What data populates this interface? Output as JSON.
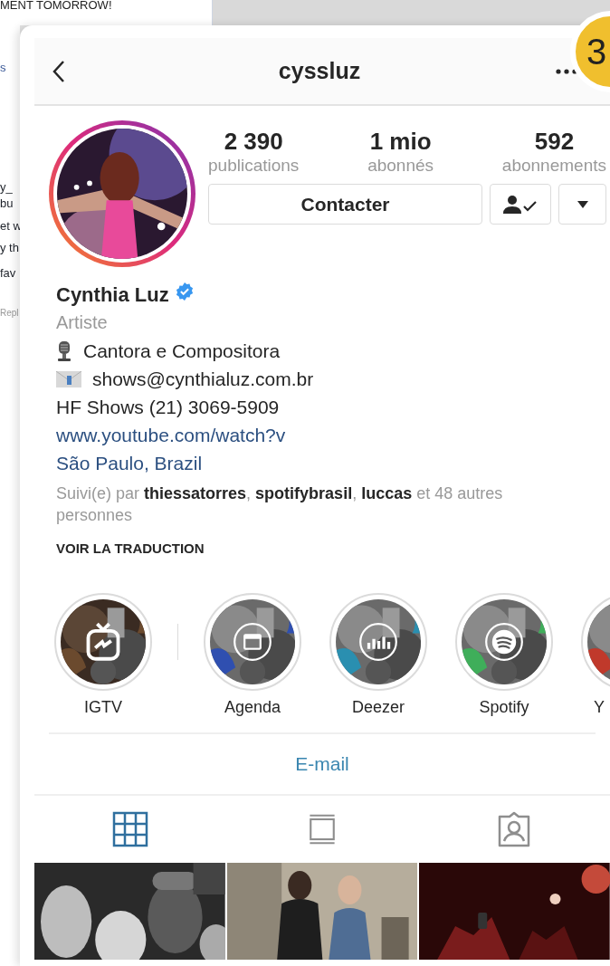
{
  "background": {
    "headline": "MENT TOMORROW!",
    "fragments": [
      {
        "text": "s",
        "kind": "link"
      },
      {
        "text": "y_",
        "kind": "text"
      },
      {
        "text": "bu",
        "kind": "text"
      },
      {
        "text": "et w",
        "kind": "text"
      },
      {
        "text": "y th",
        "kind": "text"
      },
      {
        "text": "fav",
        "kind": "text"
      },
      {
        "text": "Repl",
        "kind": "meta"
      }
    ]
  },
  "badge": "3",
  "header": {
    "title": "cyssluz"
  },
  "stats": [
    {
      "value": "2 390",
      "label": "publications"
    },
    {
      "value": "1 mio",
      "label": "abonnés"
    },
    {
      "value": "592",
      "label": "abonnements"
    }
  ],
  "buttons": {
    "contact": "Contacter",
    "following": true
  },
  "profile": {
    "name": "Cynthia Luz",
    "verified": true,
    "category": "Artiste"
  },
  "bio": [
    {
      "kind": "mic",
      "text": "Cantora e Compositora"
    },
    {
      "kind": "mail",
      "text": "shows@cynthialuz.com.br"
    },
    {
      "kind": "text",
      "text": "HF Shows (21) 3069-5909"
    },
    {
      "kind": "link",
      "text": "www.youtube.com/watch?v"
    },
    {
      "kind": "link",
      "text": "São Paulo, Brazil"
    }
  ],
  "followed_by": "Suivi(e) par **thiessatorres**, **spotifybrasil**, **luccas** et 48 autres personnes",
  "translate": "VOIR LA TRADUCTION",
  "highlights": [
    {
      "label": "IGTV",
      "kind": "tv"
    },
    {
      "label": "Agenda",
      "kind": "calendar"
    },
    {
      "label": "Deezer",
      "kind": "bars"
    },
    {
      "label": "Spotify",
      "kind": "waves"
    },
    {
      "label": "Y",
      "kind": "plain"
    }
  ],
  "email_button": "E-mail",
  "tabs": [
    {
      "kind": "grid",
      "selected": true
    },
    {
      "kind": "feed",
      "selected": false
    },
    {
      "kind": "tagged",
      "selected": false
    }
  ]
}
